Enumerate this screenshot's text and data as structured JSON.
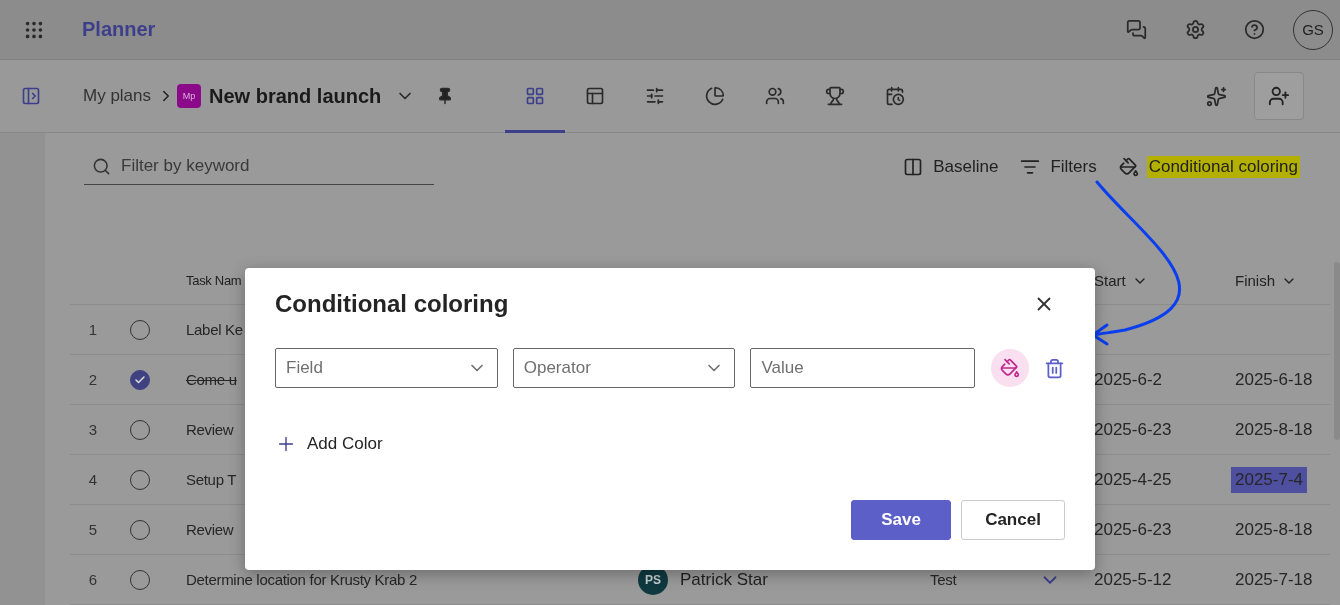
{
  "app": {
    "title": "Planner",
    "avatar": "GS"
  },
  "breadcrumb": {
    "parent": "My plans",
    "badge": "Mp",
    "plan": "New brand launch"
  },
  "views": [
    {
      "kind": "grid",
      "selected": true
    },
    {
      "kind": "board",
      "selected": false
    },
    {
      "kind": "schedule",
      "selected": false
    },
    {
      "kind": "charts",
      "selected": false
    },
    {
      "kind": "people",
      "selected": false
    },
    {
      "kind": "goals",
      "selected": false
    },
    {
      "kind": "timeline",
      "selected": false
    }
  ],
  "filter": {
    "placeholder": "Filter by keyword"
  },
  "toolbar": [
    {
      "kind": "baseline",
      "label": "Baseline",
      "highlighted": false
    },
    {
      "kind": "filters",
      "label": "Filters",
      "highlighted": false
    },
    {
      "kind": "coloring",
      "label": "Conditional coloring",
      "highlighted": true
    }
  ],
  "table": {
    "columns": {
      "task": "Task Nam",
      "start": "Start",
      "finish": "Finish"
    },
    "rows": [
      {
        "number": "1",
        "completed": false,
        "name": "Label Ke"
      },
      {
        "number": "2",
        "completed": true,
        "name": "Come u",
        "start": "2025-6-2",
        "finish": "2025-6-18",
        "finish_highlighted": false
      },
      {
        "number": "3",
        "completed": false,
        "name": "Review",
        "start": "2025-6-23",
        "finish": "2025-8-18",
        "finish_highlighted": false
      },
      {
        "number": "4",
        "completed": false,
        "name": "Setup T",
        "start": "2025-4-25",
        "finish": "2025-7-4",
        "finish_highlighted": true
      },
      {
        "number": "5",
        "completed": false,
        "name": "Review",
        "start": "2025-6-23",
        "finish": "2025-8-18",
        "finish_highlighted": false
      },
      {
        "number": "6",
        "completed": false,
        "name": "Determine location for Krusty Krab 2",
        "assignee": {
          "initials": "PS",
          "name": "Patrick Star"
        },
        "bucket": "Test",
        "start": "2025-5-12",
        "finish": "2025-7-18",
        "finish_highlighted": false
      }
    ]
  },
  "dialog": {
    "title": "Conditional coloring",
    "field": "Field",
    "operator": "Operator",
    "value_field": {
      "placeholder": "Value"
    },
    "add": "Add Color",
    "buttons": [
      {
        "kind": "primary",
        "label": "Save"
      },
      {
        "kind": "secondary",
        "label": "Cancel"
      }
    ]
  }
}
